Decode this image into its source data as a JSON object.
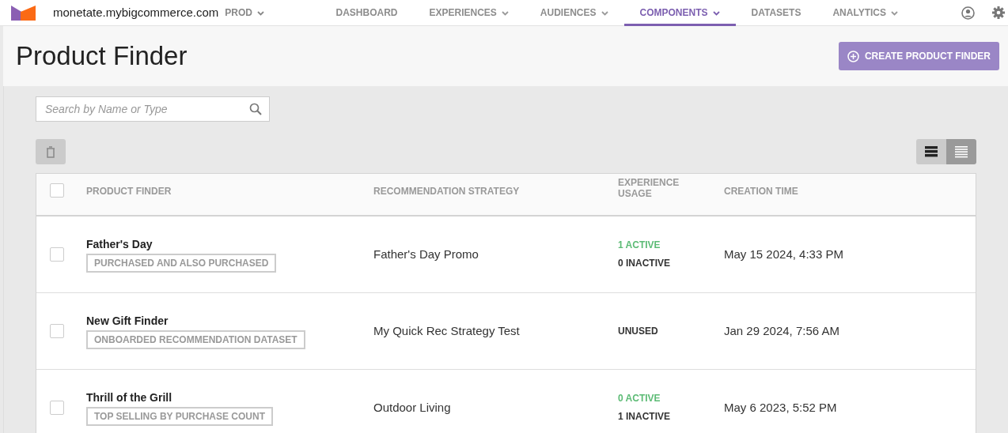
{
  "header": {
    "site": "monetate.mybigcommerce.com",
    "environment": "PROD",
    "nav": [
      {
        "label": "DASHBOARD",
        "dropdown": false,
        "selected": false
      },
      {
        "label": "EXPERIENCES",
        "dropdown": true,
        "selected": false
      },
      {
        "label": "AUDIENCES",
        "dropdown": true,
        "selected": false
      },
      {
        "label": "COMPONENTS",
        "dropdown": true,
        "selected": true
      },
      {
        "label": "DATASETS",
        "dropdown": false,
        "selected": false
      },
      {
        "label": "ANALYTICS",
        "dropdown": true,
        "selected": false
      }
    ]
  },
  "page": {
    "title": "Product Finder",
    "create_button": "CREATE PRODUCT FINDER"
  },
  "search": {
    "placeholder": "Search by Name or Type"
  },
  "view_toggle": [
    {
      "kind": "comfortable",
      "selected": false
    },
    {
      "kind": "compact",
      "selected": true
    }
  ],
  "table": {
    "all_checked": false,
    "columns": [
      "PRODUCT FINDER",
      "RECOMMENDATION STRATEGY",
      "EXPERIENCE USAGE",
      "CREATION TIME"
    ],
    "rows": [
      {
        "checked": false,
        "name": "Father's Day",
        "type": "PURCHASED AND ALSO PURCHASED",
        "strategy": "Father's Day Promo",
        "usage": [
          {
            "kind": "active",
            "text": "1 ACTIVE"
          },
          {
            "kind": "inactive",
            "text": "0 INACTIVE"
          }
        ],
        "created": "May 15 2024, 4:33 PM"
      },
      {
        "checked": false,
        "name": "New Gift Finder",
        "type": "ONBOARDED RECOMMENDATION DATASET",
        "strategy": "My Quick Rec Strategy Test",
        "usage": [
          {
            "kind": "unused",
            "text": "UNUSED"
          }
        ],
        "created": "Jan 29 2024, 7:56 AM"
      },
      {
        "checked": false,
        "name": "Thrill of the Grill",
        "type": "TOP SELLING BY PURCHASE COUNT",
        "strategy": "Outdoor Living",
        "usage": [
          {
            "kind": "active",
            "text": "0 ACTIVE"
          },
          {
            "kind": "inactive",
            "text": "1 INACTIVE"
          }
        ],
        "created": "May 6 2023, 5:52 PM"
      }
    ]
  }
}
